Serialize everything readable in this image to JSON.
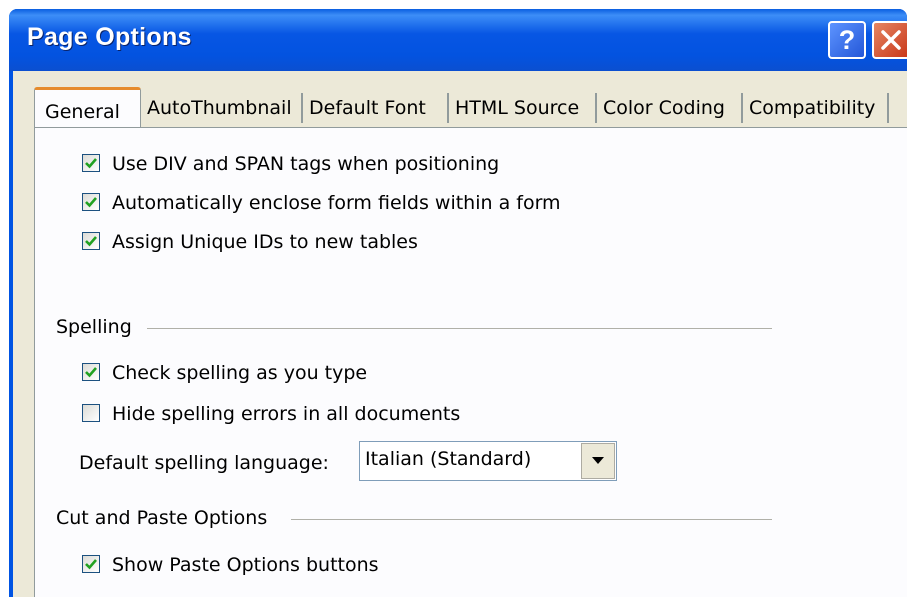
{
  "window": {
    "title": "Page Options",
    "help_label": "?",
    "close_icon": "close-icon"
  },
  "tabs": [
    {
      "label": "General",
      "active": true
    },
    {
      "label": "AutoThumbnail",
      "active": false
    },
    {
      "label": "Default Font",
      "active": false
    },
    {
      "label": "HTML Source",
      "active": false
    },
    {
      "label": "Color Coding",
      "active": false
    },
    {
      "label": "Compatibility",
      "active": false
    }
  ],
  "general": {
    "options": [
      {
        "label": "Use DIV and SPAN tags when positioning",
        "checked": true
      },
      {
        "label": "Automatically enclose form fields within a form",
        "checked": true
      },
      {
        "label": "Assign Unique IDs to new tables",
        "checked": true
      }
    ]
  },
  "spelling": {
    "group_label": "Spelling",
    "options": [
      {
        "label": "Check spelling as you type",
        "checked": true
      },
      {
        "label": "Hide spelling errors in all documents",
        "checked": false
      }
    ],
    "language_label": "Default spelling language:",
    "language_value": "Italian (Standard)"
  },
  "cut_paste": {
    "group_label": "Cut and Paste Options",
    "options": [
      {
        "label": "Show Paste Options buttons",
        "checked": true
      }
    ]
  },
  "colors": {
    "titlebar": "#0054e3",
    "tab_highlight": "#e68b2c",
    "dialog_face": "#ece9d8",
    "panel": "#fcfcfe",
    "checkmark": "#21a121"
  }
}
